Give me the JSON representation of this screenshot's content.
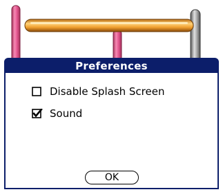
{
  "dialog": {
    "title": "Preferences",
    "options": [
      {
        "label": "Disable Splash Screen",
        "checked": false
      },
      {
        "label": "Sound",
        "checked": true
      }
    ],
    "ok_label": "OK"
  },
  "colors": {
    "titlebar": "#0c1e6a",
    "pink_post": "#e85d96",
    "gray_post": "#9a9a9a",
    "orange_bar": "#f0a030"
  }
}
